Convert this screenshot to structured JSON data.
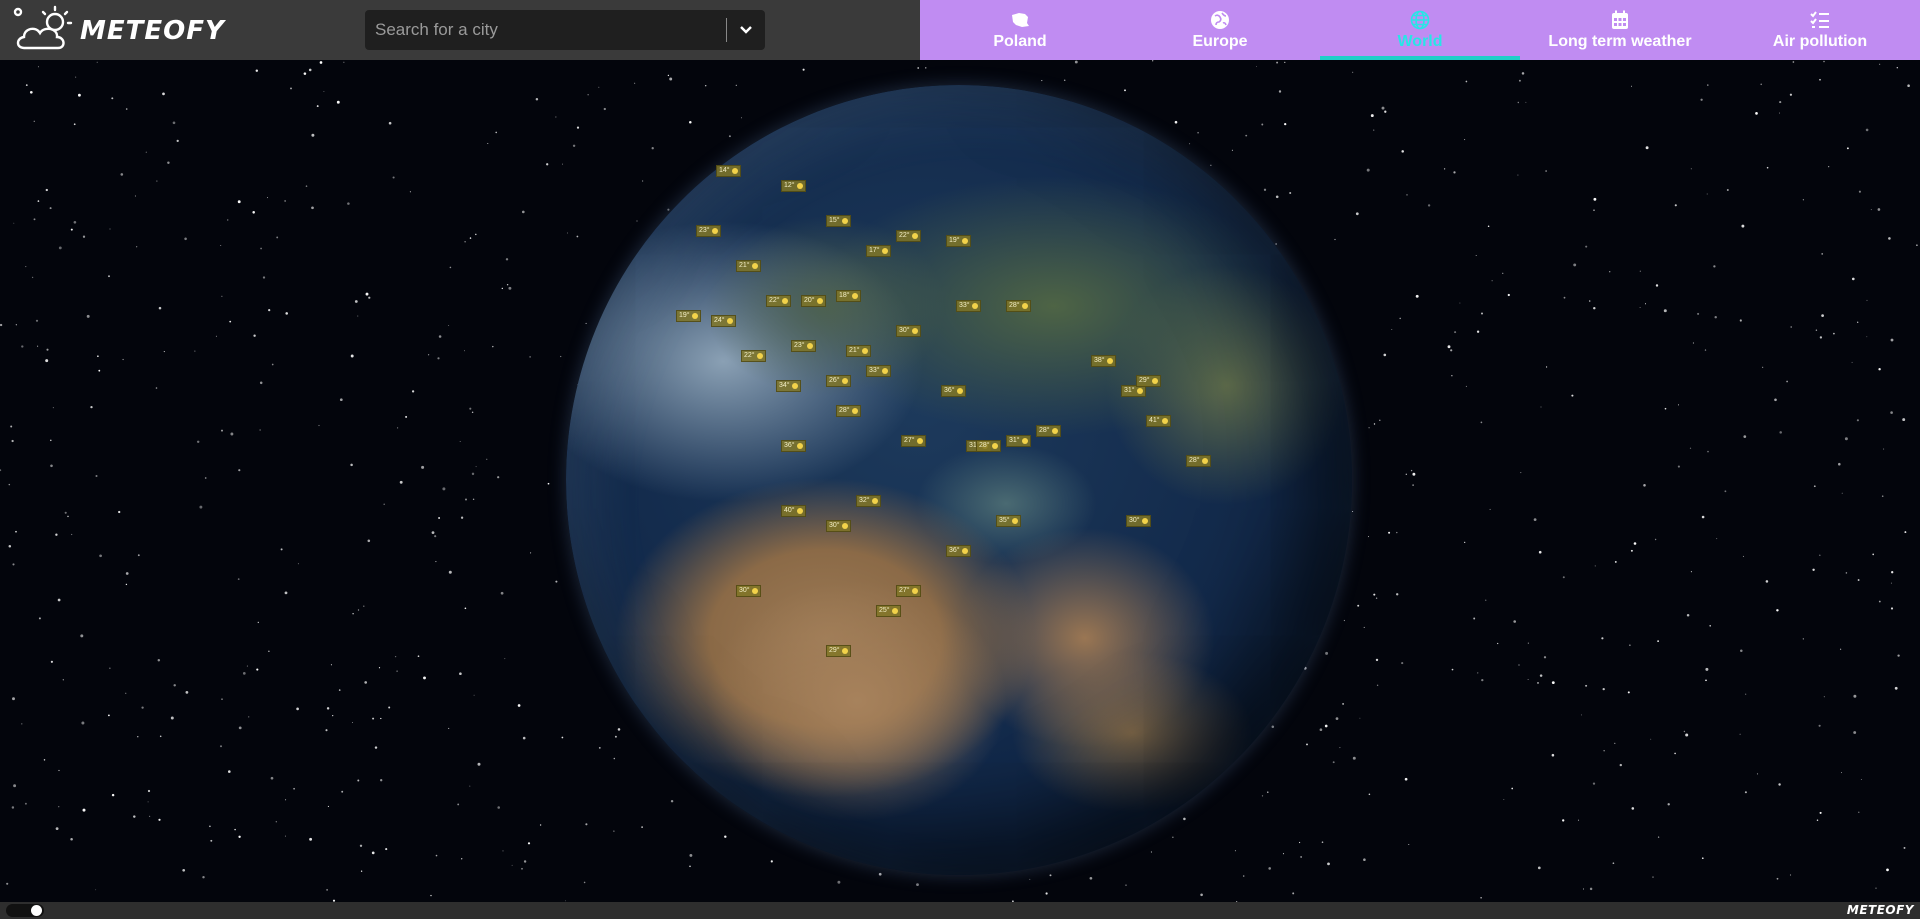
{
  "app": {
    "brand": "METEOFY",
    "footer_brand": "METEOFY"
  },
  "search": {
    "placeholder": "Search for a city",
    "value": ""
  },
  "nav": {
    "items": [
      {
        "label": "Poland",
        "icon": "poland-map-icon",
        "active": false
      },
      {
        "label": "Europe",
        "icon": "globe-europe-icon",
        "active": false
      },
      {
        "label": "World",
        "icon": "globe-icon",
        "active": true
      },
      {
        "label": "Long term weather",
        "icon": "calendar-icon",
        "active": false
      },
      {
        "label": "Air pollution",
        "icon": "checklist-icon",
        "active": false
      }
    ]
  },
  "colors": {
    "nav_bg": "#c08cf2",
    "active": "#27e6e6",
    "header_bg": "#3a3a3a",
    "marker": "#80762a"
  },
  "globe": {
    "city_temps": [
      "14°",
      "12°",
      "15°",
      "17°",
      "22°",
      "19°",
      "23°",
      "21°",
      "22°",
      "24°",
      "20°",
      "18°",
      "19°",
      "22°",
      "23°",
      "21°",
      "30°",
      "33°",
      "28°",
      "34°",
      "26°",
      "33°",
      "36°",
      "36°",
      "28°",
      "27°",
      "31°",
      "40°",
      "30°",
      "32°",
      "28°",
      "31°",
      "28°",
      "38°",
      "31°",
      "29°",
      "41°",
      "28°",
      "30°",
      "35°",
      "36°",
      "27°",
      "25°",
      "29°",
      "30°"
    ]
  }
}
